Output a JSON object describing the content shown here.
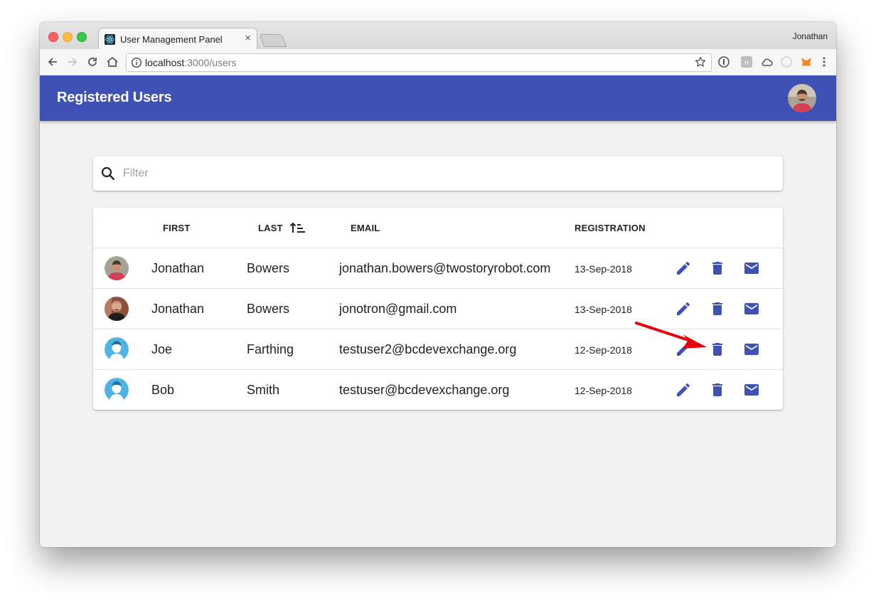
{
  "browser": {
    "tab_title": "User Management Panel",
    "tab_close": "×",
    "profile_name": "Jonathan",
    "url_host": "localhost",
    "url_path": ":3000/users"
  },
  "app": {
    "title": "Registered Users"
  },
  "filter": {
    "placeholder": "Filter",
    "value": ""
  },
  "table": {
    "columns": {
      "first": "FIRST",
      "last": "LAST",
      "email": "EMAIL",
      "registration": "REGISTRATION"
    },
    "sorted_by": "last",
    "rows": [
      {
        "first": "Jonathan",
        "last": "Bowers",
        "email": "jonathan.bowers@twostoryrobot.com",
        "registration": "13-Sep-2018",
        "avatar": "photo-red-shirt"
      },
      {
        "first": "Jonathan",
        "last": "Bowers",
        "email": "jonotron@gmail.com",
        "registration": "13-Sep-2018",
        "avatar": "photo-bald"
      },
      {
        "first": "Joe",
        "last": "Farthing",
        "email": "testuser2@bcdevexchange.org",
        "registration": "12-Sep-2018",
        "avatar": "default-person"
      },
      {
        "first": "Bob",
        "last": "Smith",
        "email": "testuser@bcdevexchange.org",
        "registration": "12-Sep-2018",
        "avatar": "default-person"
      }
    ]
  },
  "colors": {
    "primary": "#3f51b5",
    "annotation": "#e3000f"
  }
}
